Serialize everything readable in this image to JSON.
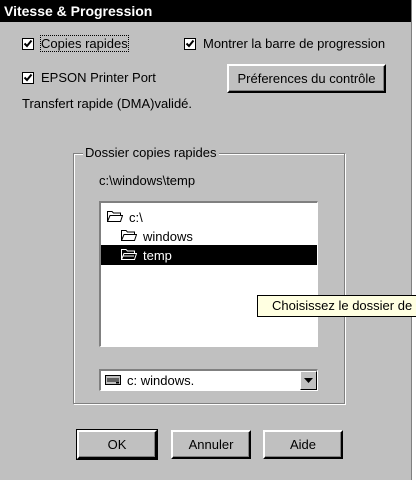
{
  "title": "Vitesse & Progression",
  "checkboxes": {
    "copies": {
      "label": "Copies rapides",
      "checked": true
    },
    "progress": {
      "label": "Montrer la barre de progression",
      "checked": true
    },
    "epson": {
      "label": "EPSON Printer Port",
      "checked": true
    }
  },
  "buttons": {
    "preferences": "Préferences du contrôle",
    "ok": "OK",
    "annuler": "Annuler",
    "aide": "Aide"
  },
  "status_text": "Transfert rapide (DMA)validé.",
  "group": {
    "title": "Dossier copies rapides",
    "current_path": "c:\\windows\\temp",
    "folders": [
      {
        "label": "c:\\",
        "selected": false
      },
      {
        "label": "windows",
        "selected": false
      },
      {
        "label": "temp",
        "selected": true
      }
    ],
    "drive_value": "c:  windows."
  },
  "tooltip": "Choisissez le dossier de",
  "icons": {
    "folder_closed": "folder-icon",
    "folder_open": "folder-open-icon",
    "drive": "drive-icon",
    "dropdown": "chevron-down-icon",
    "check": "check-icon"
  }
}
